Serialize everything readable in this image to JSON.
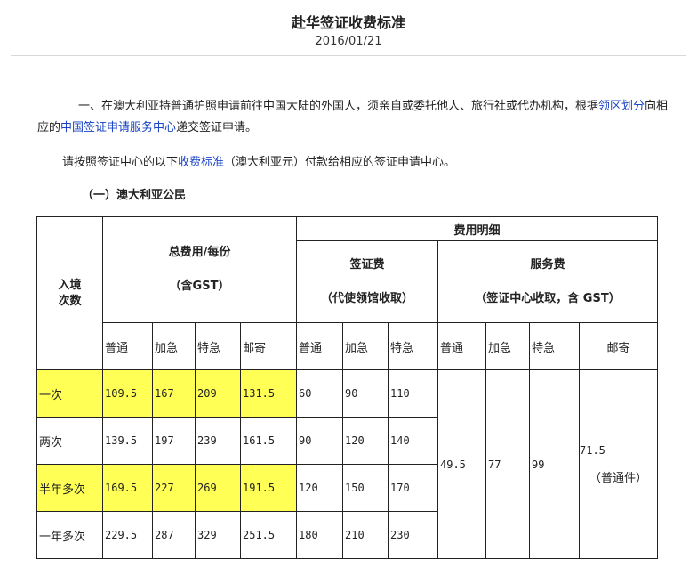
{
  "header": {
    "title": "赴华签证收费标准",
    "date": "2016/01/21"
  },
  "intro": {
    "p1_text_a": "一、在澳大利亚持普通护照申请前往中国大陆的外国人，须亲自或委托他人、旅行社或代办机构，根据",
    "p1_link_a": "领区划分",
    "p1_text_b": "向相应的",
    "p1_link_b": "中国签证申请服务中心",
    "p1_text_c": "递交签证申请。",
    "p2_text_a": "请按照签证中心的以下",
    "p2_link": "收费标准",
    "p2_text_b": "（澳大利亚元）付款给相应的签证申请中心。",
    "section_heading": "（一）澳大利亚公民"
  },
  "table": {
    "entry_header_line1": "入境",
    "entry_header_line2": "次数",
    "detail_header": "费用明细",
    "total_header_line1": "总费用/每份",
    "total_header_line2": "（含GST）",
    "visa_fee_header_line1": "签证费",
    "visa_fee_header_line2": "（代使领馆收取）",
    "service_fee_header_line1": "服务费",
    "service_fee_header_line2": "（签证中心收取，含 GST）",
    "total_cols": [
      "普通",
      "加急",
      "特急",
      "邮寄"
    ],
    "visa_cols": [
      "普通",
      "加急",
      "特急"
    ],
    "service_cols": [
      "普通",
      "加急",
      "特急",
      "邮寄"
    ],
    "rows": [
      {
        "entry": "一次",
        "total": [
          "109.5",
          "167",
          "209",
          "131.5"
        ],
        "visa": [
          "60",
          "90",
          "110"
        ]
      },
      {
        "entry": "两次",
        "total": [
          "139.5",
          "197",
          "239",
          "161.5"
        ],
        "visa": [
          "90",
          "120",
          "140"
        ]
      },
      {
        "entry": "半年多次",
        "total": [
          "169.5",
          "227",
          "269",
          "191.5"
        ],
        "visa": [
          "120",
          "150",
          "170"
        ]
      },
      {
        "entry": "一年多次",
        "total": [
          "229.5",
          "287",
          "329",
          "251.5"
        ],
        "visa": [
          "180",
          "210",
          "230"
        ]
      }
    ],
    "service": {
      "normal": "49.5",
      "urgent": "77",
      "express": "99",
      "mail_value": "71.5",
      "mail_note": "（普通件）"
    }
  },
  "colors": {
    "highlight": "#ffff55",
    "link": "#1a44c4",
    "border": "#222222"
  }
}
